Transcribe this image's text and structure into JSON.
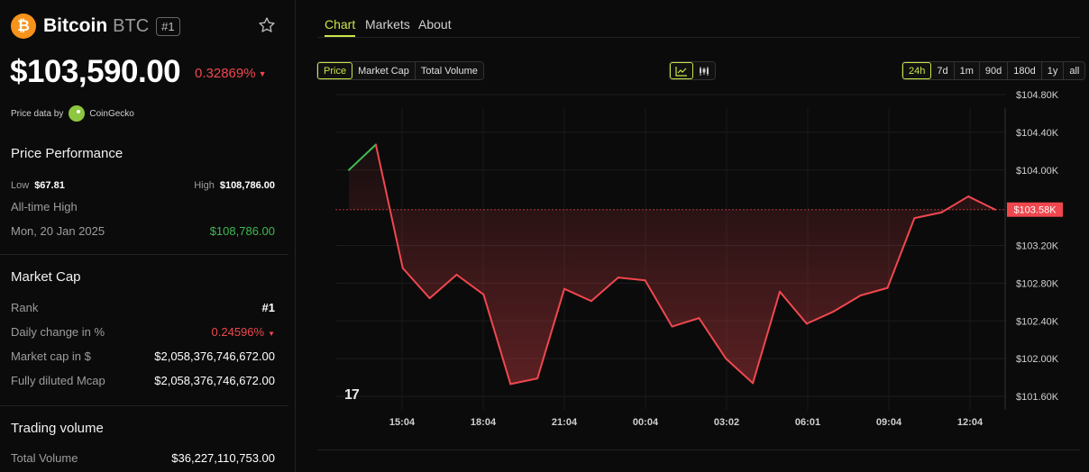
{
  "coin": {
    "logo_symbol": "₿",
    "name": "Bitcoin",
    "symbol": "BTC",
    "rank_badge": "#1"
  },
  "price": {
    "value": "$103,590.00",
    "change": "0.32869%",
    "direction": "down"
  },
  "price_data": {
    "label": "Price data by",
    "provider": "CoinGecko"
  },
  "performance": {
    "title": "Price Performance",
    "low_label": "Low",
    "low_value": "$67.81",
    "high_label": "High",
    "high_value": "$108,786.00",
    "ath_label": "All-time High",
    "ath_date": "Mon, 20 Jan 2025",
    "ath_value": "$108,786.00"
  },
  "market_cap": {
    "title": "Market Cap",
    "rows": [
      {
        "label": "Rank",
        "value": "#1"
      },
      {
        "label": "Daily change in %",
        "value": "0.24596%"
      },
      {
        "label": "Market cap in $",
        "value": "$2,058,376,746,672.00"
      },
      {
        "label": "Fully diluted Mcap",
        "value": "$2,058,376,746,672.00"
      }
    ]
  },
  "trading_volume": {
    "title": "Trading volume",
    "rows": [
      {
        "label": "Total Volume",
        "value": "$36,227,110,753.00"
      }
    ]
  },
  "tabs": [
    "Chart",
    "Markets",
    "About"
  ],
  "active_tab": "Chart",
  "metric_buttons": [
    "Price",
    "Market Cap",
    "Total Volume"
  ],
  "active_metric": "Price",
  "chart_style_icons": [
    "line-chart-icon",
    "candlestick-icon"
  ],
  "ranges": [
    "24h",
    "7d",
    "1m",
    "90d",
    "180d",
    "1y",
    "all"
  ],
  "active_range": "24h",
  "colors": {
    "accent": "#c8e64a",
    "up": "#3fb950",
    "down": "#f0474e",
    "bitcoin": "#f7931a"
  },
  "chart_data": {
    "type": "line",
    "x_ticks": [
      "15:04",
      "18:04",
      "21:04",
      "00:04",
      "03:02",
      "06:01",
      "09:04",
      "12:04"
    ],
    "y_ticks": [
      "$104.80K",
      "$104.40K",
      "$104.00K",
      "$103.20K",
      "$102.80K",
      "$102.40K",
      "$102.00K",
      "$101.60K"
    ],
    "ylim": [
      101.6,
      104.8
    ],
    "reference_value": 103.58,
    "current_label": "$103.58K",
    "series": [
      {
        "values": [
          104.0,
          104.27,
          102.96,
          102.64,
          102.89,
          102.68,
          101.73,
          101.79,
          102.74,
          102.61,
          102.86,
          102.83,
          102.34,
          102.43,
          102.0,
          101.74,
          102.71,
          102.37,
          102.5,
          102.67,
          102.75,
          103.49,
          103.55,
          103.72,
          103.58
        ]
      }
    ],
    "grid": true
  }
}
